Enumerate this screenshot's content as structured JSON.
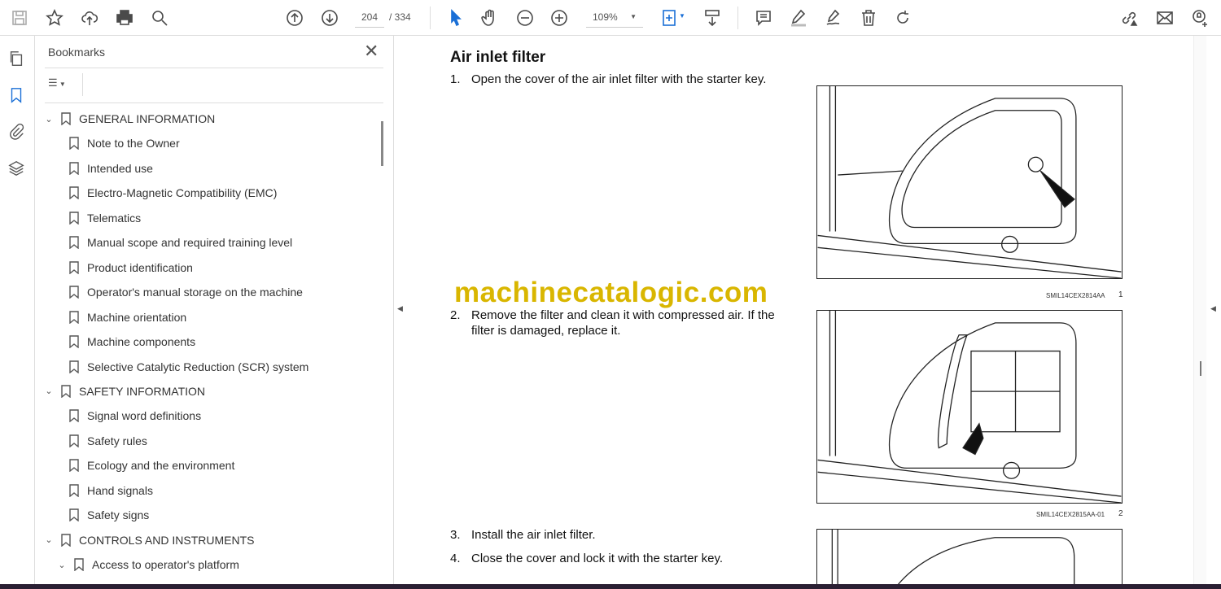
{
  "toolbar": {
    "page_current": "204",
    "page_total": "/ 334",
    "zoom": "109%",
    "icons": [
      "save-icon",
      "star-icon",
      "cloud-upload-icon",
      "print-icon",
      "find-icon",
      "page-up-icon",
      "page-down-icon",
      "select-cursor-icon",
      "hand-icon",
      "zoom-out-icon",
      "zoom-in-icon",
      "fit-page-icon",
      "scroll-mode-icon",
      "comment-icon",
      "highlight-icon",
      "sign-icon",
      "delete-icon",
      "rotate-icon",
      "share-link-icon",
      "email-icon",
      "add-user-icon"
    ]
  },
  "panel": {
    "title": "Bookmarks",
    "close": "✕",
    "items": [
      {
        "label": "GENERAL INFORMATION",
        "level": 1,
        "expanded": true
      },
      {
        "label": "Note to the Owner",
        "level": 2
      },
      {
        "label": "Intended use",
        "level": 2
      },
      {
        "label": "Electro-Magnetic Compatibility (EMC)",
        "level": 2
      },
      {
        "label": "Telematics",
        "level": 2
      },
      {
        "label": "Manual scope and required training level",
        "level": 2
      },
      {
        "label": "Product identification",
        "level": 2
      },
      {
        "label": "Operator's manual storage on the machine",
        "level": 2
      },
      {
        "label": "Machine orientation",
        "level": 2
      },
      {
        "label": "Machine components",
        "level": 2
      },
      {
        "label": "Selective Catalytic Reduction (SCR) system",
        "level": 2
      },
      {
        "label": "SAFETY INFORMATION",
        "level": 1,
        "expanded": true
      },
      {
        "label": "Signal word definitions",
        "level": 2
      },
      {
        "label": "Safety rules",
        "level": 2
      },
      {
        "label": "Ecology and the environment",
        "level": 2
      },
      {
        "label": "Hand signals",
        "level": 2
      },
      {
        "label": "Safety signs",
        "level": 2
      },
      {
        "label": "CONTROLS AND INSTRUMENTS",
        "level": 1,
        "expanded": true
      },
      {
        "label": "Access to operator's platform",
        "level": 2,
        "expanded": true
      }
    ]
  },
  "document": {
    "heading": "Air inlet filter",
    "steps": [
      {
        "n": "1.",
        "text": "Open the cover of the air inlet filter with the starter key."
      },
      {
        "n": "2.",
        "text": "Remove the filter and clean it with compressed air.  If the filter is damaged, replace it."
      },
      {
        "n": "3.",
        "text": "Install the air inlet filter."
      },
      {
        "n": "4.",
        "text": "Close the cover and lock it with the starter key."
      }
    ],
    "figures": [
      {
        "code": "SMIL14CEX2814AA",
        "num": "1"
      },
      {
        "code": "SMIL14CEX2815AA-01",
        "num": "2"
      }
    ],
    "watermark": "machinecatalogic.com"
  }
}
